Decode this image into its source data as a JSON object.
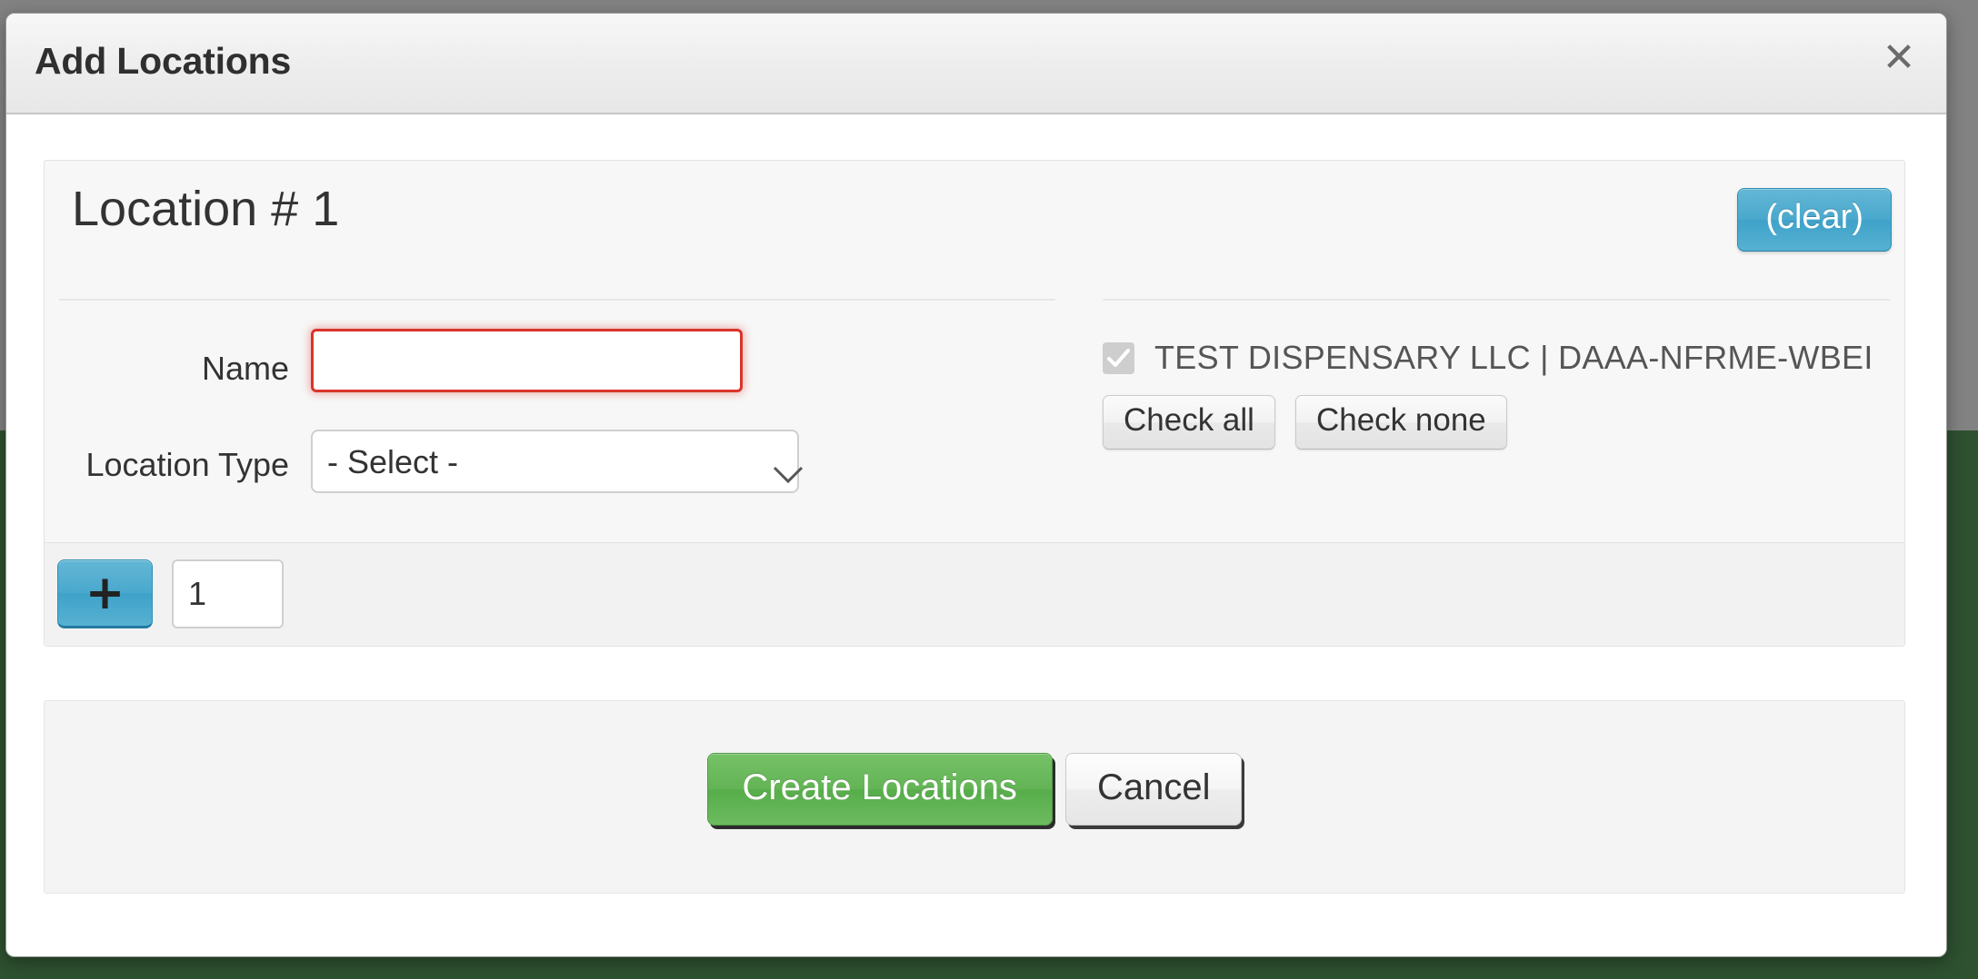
{
  "window": {
    "title": "Add Locations",
    "close_icon": "close-icon"
  },
  "location_block": {
    "heading": "Location # 1",
    "clear_label": "(clear)",
    "fields": [
      {
        "label": "Name",
        "value": "",
        "placeholder": "",
        "state": "invalid"
      },
      {
        "label": "Location Type",
        "value": "- Select -",
        "options": [
          "- Select -"
        ]
      }
    ]
  },
  "licenses": {
    "items": [
      {
        "label": "TEST DISPENSARY LLC | DAAA-NFRME-WBEI",
        "checked": true,
        "disabled": true
      }
    ],
    "check_all_label": "Check all",
    "check_none_label": "Check none"
  },
  "add_row": {
    "plus_icon": "plus-icon",
    "plus_label": "+",
    "count_value": "1"
  },
  "footer": {
    "create_label": "Create Locations",
    "cancel_label": "Cancel"
  },
  "colors": {
    "accent_blue": "#49a8cd",
    "create_green": "#63b456",
    "invalid_red": "#d9342b",
    "backdrop_green": "#2e5130",
    "backdrop_gray": "#828282"
  }
}
